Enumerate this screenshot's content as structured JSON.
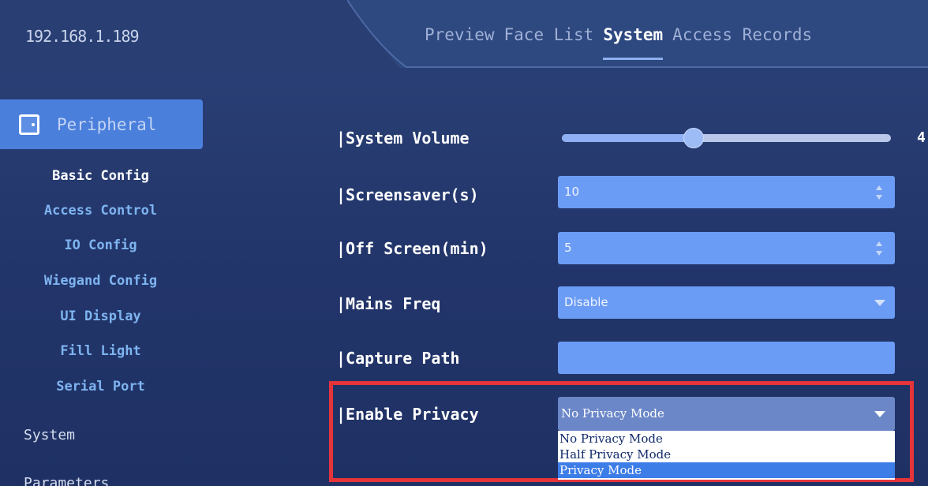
{
  "header": {
    "ip": "192.168.1.189",
    "tabs": [
      {
        "label": "Preview",
        "active": false
      },
      {
        "label": "Face List",
        "active": false
      },
      {
        "label": "System",
        "active": true
      },
      {
        "label": "Access Records",
        "active": false
      }
    ]
  },
  "sidebar": {
    "active_section": "Peripheral",
    "active_icon": "door-icon",
    "items": [
      {
        "label": "Basic Config",
        "current": true
      },
      {
        "label": "Access Control"
      },
      {
        "label": "IO Config"
      },
      {
        "label": "Wiegand Config"
      },
      {
        "label": "UI Display"
      },
      {
        "label": "Fill Light"
      },
      {
        "label": "Serial Port"
      }
    ],
    "system_label": "System",
    "partial_label": "Parameters"
  },
  "form": {
    "system_volume": {
      "label": "|System Volume",
      "value": 4,
      "max": 10
    },
    "screensaver": {
      "label": "|Screensaver(s)",
      "value": "10"
    },
    "off_screen": {
      "label": "|Off Screen(min)",
      "value": "5"
    },
    "mains_freq": {
      "label": "|Mains Freq",
      "value": "Disable"
    },
    "capture_path": {
      "label": "|Capture Path",
      "value": ""
    },
    "enable_privacy": {
      "label": "|Enable Privacy",
      "value": "No Privacy Mode",
      "options": [
        "No Privacy Mode",
        "Half Privacy Mode",
        "Privacy Mode"
      ],
      "highlighted": "Privacy Mode"
    }
  },
  "colors": {
    "highlight_box": "#e5343a",
    "accent": "#4a7fdc"
  }
}
